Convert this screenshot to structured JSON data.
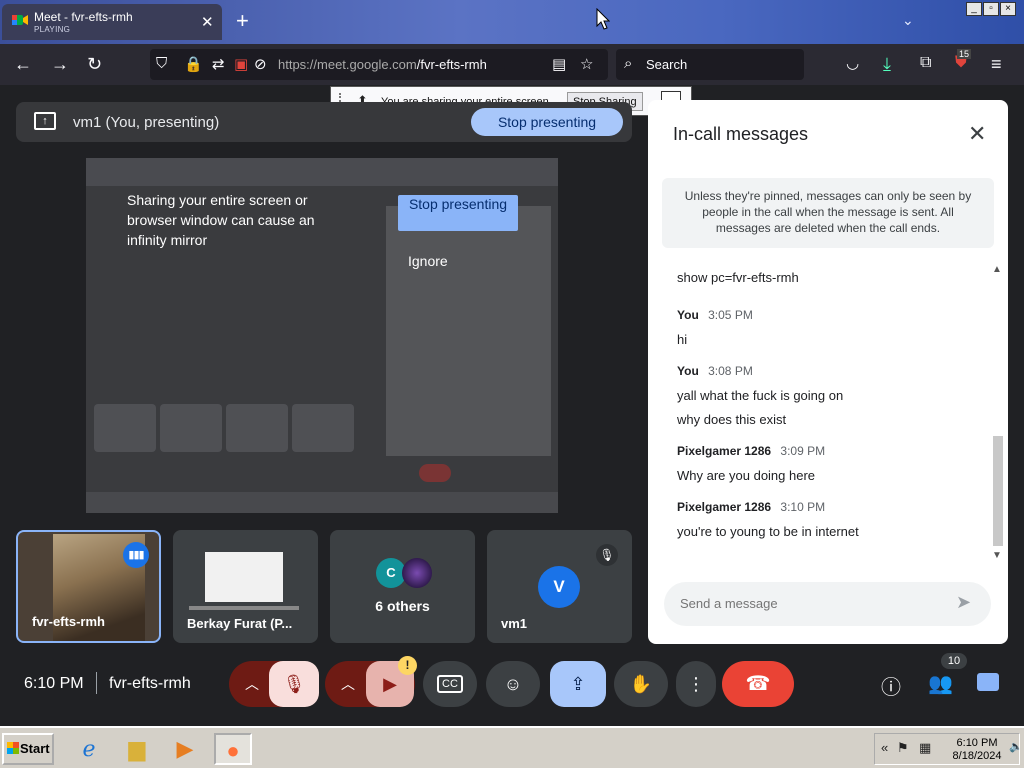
{
  "browser": {
    "tab_title": "Meet - fvr-efts-rmh",
    "tab_status": "PLAYING",
    "url_prefix": "https://meet.google.com",
    "url_path": "/fvr-efts-rmh",
    "search_placeholder": "Search",
    "ext_badge": "15",
    "window_min": "_",
    "window_max": "▫",
    "window_close": "×"
  },
  "share_banner": {
    "text": "You are sharing your entire screen.",
    "stop_label": "Stop Sharing",
    "minimize": "_"
  },
  "presenting": {
    "label": "vm1 (You, presenting)",
    "stop_label": "Stop presenting",
    "mirror_warning": "Sharing your entire screen or browser window can cause an infinity mirror",
    "mirror_stop_label": "Stop presenting",
    "mirror_ignore_label": "Ignore"
  },
  "tiles": [
    {
      "name": "fvr-efts-rmh"
    },
    {
      "name": "Berkay Furat (P..."
    },
    {
      "name": "6 others",
      "avatar_letter": "C"
    },
    {
      "name": "vm1",
      "avatar_letter": "V"
    }
  ],
  "chat": {
    "title": "In-call messages",
    "note": "Unless they're pinned, messages can only be seen by people in the call when the message is sent. All messages are deleted when the call ends.",
    "first_line": "show pc=fvr-efts-rmh",
    "messages": [
      {
        "sender": "You",
        "time": "3:05 PM",
        "lines": [
          "hi"
        ]
      },
      {
        "sender": "You",
        "time": "3:08 PM",
        "lines": [
          "yall what the fuck is going on",
          "why does this exist"
        ]
      },
      {
        "sender": "Pixelgamer 1286",
        "time": "3:09 PM",
        "lines": [
          "Why are you doing here"
        ]
      },
      {
        "sender": "Pixelgamer 1286",
        "time": "3:10 PM",
        "lines": [
          "you're to young to be in internet"
        ]
      }
    ],
    "input_placeholder": "Send a message"
  },
  "controls": {
    "clock": "6:10 PM",
    "meeting_code": "fvr-efts-rmh",
    "cc_label": "CC",
    "warning_mark": "!",
    "people_count": "10"
  },
  "taskbar": {
    "start_label": "Start",
    "tray_time": "6:10 PM",
    "tray_date": "8/18/2024"
  },
  "colors": {
    "accent": "#a8c7fa",
    "hangup": "#ea4335",
    "panel_bg": "#ffffff",
    "meet_bg": "#202124"
  }
}
